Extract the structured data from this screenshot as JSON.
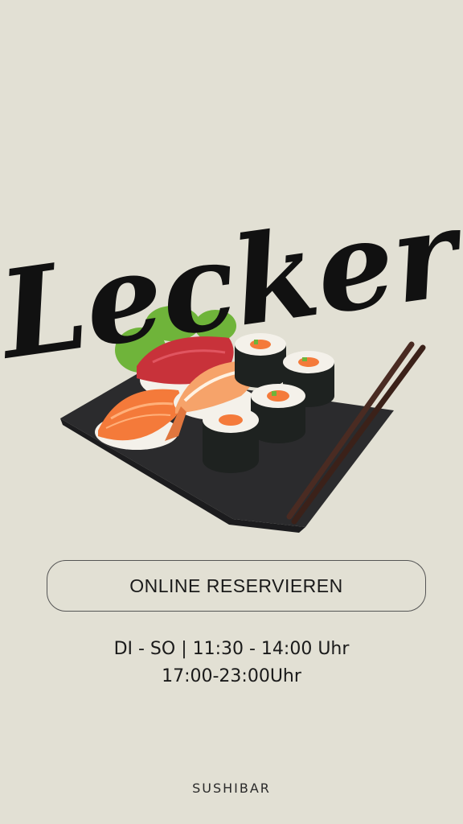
{
  "hero": {
    "script_title": "Lecker",
    "image_icon": "sushi-platter-illustration"
  },
  "cta": {
    "label": "ONLINE RESERVIEREN"
  },
  "hours": {
    "line1": "DI - SO |  11:30 - 14:00 Uhr",
    "line2": "17:00-23:00Uhr"
  },
  "footer": {
    "brand": "SUSHIBAR"
  },
  "colors": {
    "background": "#e2e0d4",
    "text": "#1a1a1a",
    "slate": "#2b2b2d",
    "salmon": "#f47a3a",
    "tuna": "#c8323a",
    "nori": "#1e2220",
    "rice": "#f4f1ea",
    "chopsticks": "#4a2b22",
    "lettuce": "#6fb43a"
  }
}
